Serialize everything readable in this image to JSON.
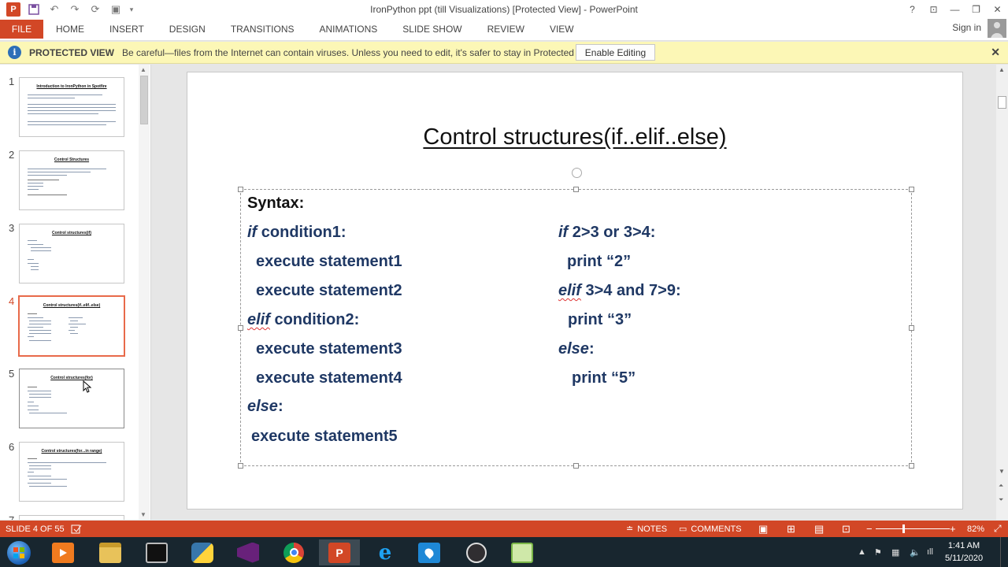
{
  "window": {
    "title": "IronPython ppt (till Visualizations) [Protected View] - PowerPoint"
  },
  "ribbon": {
    "file_label": "FILE",
    "tabs": [
      "HOME",
      "INSERT",
      "DESIGN",
      "TRANSITIONS",
      "ANIMATIONS",
      "SLIDE SHOW",
      "REVIEW",
      "VIEW"
    ],
    "signin_label": "Sign in"
  },
  "protected_bar": {
    "title": "PROTECTED VIEW",
    "message": "Be careful—files from the Internet can contain viruses. Unless you need to edit, it's safer to stay in Protected View.",
    "button_label": "Enable Editing"
  },
  "thumbnails": [
    {
      "number": "1",
      "title": "Introduction to IronPython in Spotfire"
    },
    {
      "number": "2",
      "title": "Control Structures"
    },
    {
      "number": "3",
      "title": "Control structures(if)"
    },
    {
      "number": "4",
      "title": "Control structures(if..elif..else)"
    },
    {
      "number": "5",
      "title": "Control structures(for)"
    },
    {
      "number": "6",
      "title": "Control structures(for...in range)"
    },
    {
      "number": "7",
      "title": ""
    }
  ],
  "slide": {
    "title": "Control structures(if..elif..else)",
    "syntax_label": "Syntax:",
    "left": {
      "l1_kw": "if",
      "l1_rest": " condition1:",
      "l2": "execute statement1",
      "l3": "execute statement2",
      "l4_kw": "elif",
      "l4_rest": " condition2:",
      "l5": "execute statement3",
      "l6": "execute statement4",
      "l7_kw": "else",
      "l7_rest": ":",
      "l8": "execute statement5"
    },
    "right": {
      "r1_kw": "if",
      "r1_rest": " 2>3 or 3>4:",
      "r2": "print “2”",
      "r3_kw": "elif",
      "r3_rest": " 3>4 and 7>9:",
      "r4": "print “3”",
      "r5_kw": "else",
      "r5_rest": ":",
      "r6": "print “5”"
    }
  },
  "statusbar": {
    "slide_indicator": "SLIDE 4 OF 55",
    "notes_label": "NOTES",
    "comments_label": "COMMENTS",
    "zoom": "82%"
  },
  "taskbar": {
    "time": "1:41 AM",
    "date": "5/11/2020"
  },
  "colors": {
    "accent": "#d24726",
    "slide_text": "#1f3864",
    "protected_bar": "#fcf7b6",
    "taskbar": "#18262f"
  }
}
